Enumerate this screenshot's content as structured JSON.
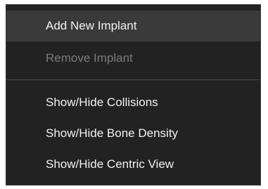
{
  "context_menu": {
    "items": [
      {
        "label": "Add New Implant",
        "state": "highlighted"
      },
      {
        "label": "Remove Implant",
        "state": "disabled"
      },
      {
        "label": "Show/Hide Collisions",
        "state": "normal"
      },
      {
        "label": "Show/Hide Bone Density",
        "state": "normal"
      },
      {
        "label": "Show/Hide Centric View",
        "state": "normal"
      }
    ]
  },
  "colors": {
    "menu_background": "#222222",
    "highlight_background": "#3a3a3a",
    "text": "#f2f2f2",
    "disabled_text": "#7b7b7b",
    "separator": "#4a4a4a"
  }
}
